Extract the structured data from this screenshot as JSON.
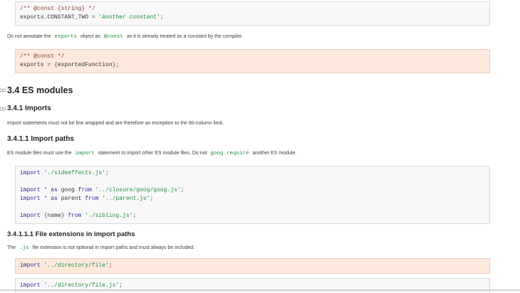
{
  "colors": {
    "page_bg": "#ffffff",
    "code_block_bg": "#f8f8f8",
    "code_block_border": "#d9d9d9",
    "bad_code_bg": "#fce9dc",
    "bad_code_border": "#ecceba",
    "syntax_comment": "#8b3a2e",
    "syntax_keyword": "#2a2a9d",
    "syntax_string": "#1e8e3e",
    "inline_code_green": "#1e8e3e",
    "heading_text": "#222222",
    "body_text": "#3c3c3c",
    "anchor_icon_gray": "#b0b0b0"
  },
  "headings": {
    "es_modules": "3.4 ES modules",
    "imports": "3.4.1 Imports",
    "import_paths": "3.4.1.1 Import paths",
    "file_extensions": "3.4.1.1.1 File extensions in import paths"
  },
  "paragraphs": {
    "exports_note": [
      {
        "t": "Do not annotate the "
      },
      {
        "t": "exports",
        "code": true
      },
      {
        "t": " object as "
      },
      {
        "t": "@const",
        "code": true
      },
      {
        "t": " as it is already treated as a constant by the compiler."
      }
    ],
    "imports_rule": [
      {
        "t": "Import statements must not be line wrapped and are therefore an exception to the 80-column limit."
      }
    ],
    "import_paths_rule": [
      {
        "t": "ES module files must use the "
      },
      {
        "t": "import",
        "code": true
      },
      {
        "t": " statement to import other ES module files. Do not "
      },
      {
        "t": "goog.require",
        "code": true
      },
      {
        "t": " another ES module."
      }
    ],
    "file_ext_rule": [
      {
        "t": "The "
      },
      {
        "t": ".js",
        "code": true
      },
      {
        "t": " file extension is not optional in import paths and must always be included."
      }
    ]
  },
  "code_blocks": {
    "exports_const_good": {
      "variant": "good",
      "lines": [
        [
          {
            "t": "/** @const {string} */",
            "c": "com"
          }
        ],
        [
          {
            "t": "exports.CONSTANT_TWO ",
            "c": "pln"
          },
          {
            "t": "= ",
            "c": "pun"
          },
          {
            "t": "'Another constant'",
            "c": "str"
          },
          {
            "t": ";",
            "c": "pun"
          }
        ]
      ]
    },
    "exports_bad": {
      "variant": "bad",
      "lines": [
        [
          {
            "t": "/** @const */",
            "c": "com"
          }
        ],
        [
          {
            "t": "exports ",
            "c": "pln"
          },
          {
            "t": "= {",
            "c": "pun"
          },
          {
            "t": "exportedFunction",
            "c": "pln"
          },
          {
            "t": "};",
            "c": "pun"
          }
        ]
      ]
    },
    "imports_example": {
      "variant": "good",
      "lines": [
        [
          {
            "t": "import ",
            "c": "kwd"
          },
          {
            "t": "'./sideeffects.js'",
            "c": "str"
          },
          {
            "t": ";",
            "c": "pun"
          }
        ],
        [],
        [
          {
            "t": "import ",
            "c": "kwd"
          },
          {
            "t": "* ",
            "c": "pun"
          },
          {
            "t": "as ",
            "c": "kwd"
          },
          {
            "t": "goog ",
            "c": "pln"
          },
          {
            "t": "from ",
            "c": "kwd"
          },
          {
            "t": "'../closure/goog/goog.js'",
            "c": "str"
          },
          {
            "t": ";",
            "c": "pun"
          }
        ],
        [
          {
            "t": "import ",
            "c": "kwd"
          },
          {
            "t": "* ",
            "c": "pun"
          },
          {
            "t": "as ",
            "c": "kwd"
          },
          {
            "t": "parent ",
            "c": "pln"
          },
          {
            "t": "from ",
            "c": "kwd"
          },
          {
            "t": "'../parent.js'",
            "c": "str"
          },
          {
            "t": ";",
            "c": "pun"
          }
        ],
        [],
        [
          {
            "t": "import ",
            "c": "kwd"
          },
          {
            "t": "{",
            "c": "pun"
          },
          {
            "t": "name",
            "c": "pln"
          },
          {
            "t": "} ",
            "c": "pun"
          },
          {
            "t": "from ",
            "c": "kwd"
          },
          {
            "t": "'./sibling.js'",
            "c": "str"
          },
          {
            "t": ";",
            "c": "pun"
          }
        ]
      ]
    },
    "import_no_ext_bad": {
      "variant": "bad",
      "lines": [
        [
          {
            "t": "import ",
            "c": "kwd"
          },
          {
            "t": "'../directory/file'",
            "c": "str"
          },
          {
            "t": ";",
            "c": "pun"
          }
        ]
      ]
    },
    "import_ext_good": {
      "variant": "good",
      "lines": [
        [
          {
            "t": "import ",
            "c": "kwd"
          },
          {
            "t": "'../directory/file.js'",
            "c": "str"
          },
          {
            "t": ";",
            "c": "pun"
          }
        ]
      ]
    }
  }
}
